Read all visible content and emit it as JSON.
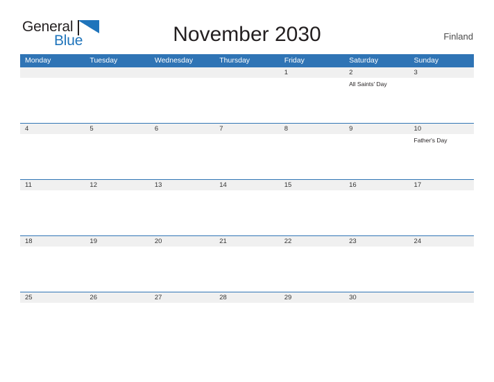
{
  "brand": {
    "name_part1": "General",
    "name_part2": "Blue",
    "flag_icon": "blue-flag-icon",
    "accent_color": "#1f74bb"
  },
  "header": {
    "title": "November 2030",
    "country": "Finland"
  },
  "theme": {
    "header_bg": "#2f74b5",
    "header_text": "#ffffff",
    "date_band_bg": "#f0f0f0",
    "row_rule": "#2f74b5",
    "body_bg": "#ffffff",
    "text": "#231f20"
  },
  "calendar": {
    "day_headers": [
      "Monday",
      "Tuesday",
      "Wednesday",
      "Thursday",
      "Friday",
      "Saturday",
      "Sunday"
    ],
    "weeks": [
      {
        "days": [
          {
            "date": "",
            "events": []
          },
          {
            "date": "",
            "events": []
          },
          {
            "date": "",
            "events": []
          },
          {
            "date": "",
            "events": []
          },
          {
            "date": "1",
            "events": []
          },
          {
            "date": "2",
            "events": [
              "All Saints' Day"
            ]
          },
          {
            "date": "3",
            "events": []
          }
        ]
      },
      {
        "days": [
          {
            "date": "4",
            "events": []
          },
          {
            "date": "5",
            "events": []
          },
          {
            "date": "6",
            "events": []
          },
          {
            "date": "7",
            "events": []
          },
          {
            "date": "8",
            "events": []
          },
          {
            "date": "9",
            "events": []
          },
          {
            "date": "10",
            "events": [
              "Father's Day"
            ]
          }
        ]
      },
      {
        "days": [
          {
            "date": "11",
            "events": []
          },
          {
            "date": "12",
            "events": []
          },
          {
            "date": "13",
            "events": []
          },
          {
            "date": "14",
            "events": []
          },
          {
            "date": "15",
            "events": []
          },
          {
            "date": "16",
            "events": []
          },
          {
            "date": "17",
            "events": []
          }
        ]
      },
      {
        "days": [
          {
            "date": "18",
            "events": []
          },
          {
            "date": "19",
            "events": []
          },
          {
            "date": "20",
            "events": []
          },
          {
            "date": "21",
            "events": []
          },
          {
            "date": "22",
            "events": []
          },
          {
            "date": "23",
            "events": []
          },
          {
            "date": "24",
            "events": []
          }
        ]
      },
      {
        "days": [
          {
            "date": "25",
            "events": []
          },
          {
            "date": "26",
            "events": []
          },
          {
            "date": "27",
            "events": []
          },
          {
            "date": "28",
            "events": []
          },
          {
            "date": "29",
            "events": []
          },
          {
            "date": "30",
            "events": []
          },
          {
            "date": "",
            "events": []
          }
        ]
      }
    ]
  }
}
